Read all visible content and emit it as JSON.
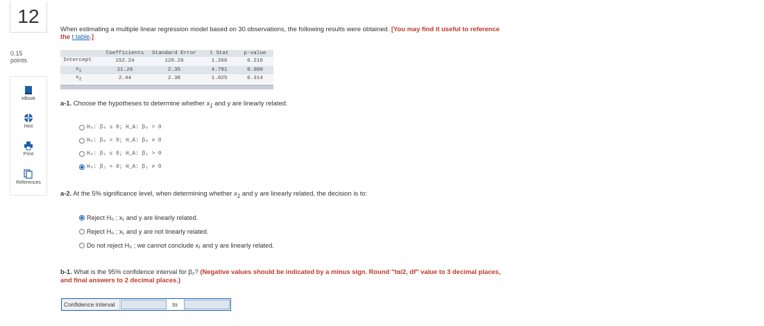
{
  "question": {
    "number": "12",
    "points_value": "0.15",
    "points_label": "points"
  },
  "tools": [
    {
      "label": "eBook",
      "icon": "book-icon"
    },
    {
      "label": "Hint",
      "icon": "lifebuoy-icon"
    },
    {
      "label": "Print",
      "icon": "printer-icon"
    },
    {
      "label": "References",
      "icon": "documents-icon"
    }
  ],
  "intro": {
    "text": "When estimating a multiple linear regression model based on 30 observations, the following results were obtained.",
    "note_prefix": "[You may find it useful to reference the",
    "link": "t table",
    "note_suffix": ".]"
  },
  "regression_table": {
    "headers": [
      "",
      "Coefficients",
      "Standard Error",
      "t Stat",
      "p-value"
    ],
    "rows": [
      {
        "label": "Intercept",
        "sub": "",
        "coef": "152.24",
        "se": "120.26",
        "t": "1.266",
        "p": "0.216"
      },
      {
        "label": "x",
        "sub": "1",
        "coef": "11.26",
        "se": "2.35",
        "t": "4.791",
        "p": "0.000"
      },
      {
        "label": "x",
        "sub": "2",
        "coef": "2.44",
        "se": "2.38",
        "t": "1.025",
        "p": "0.314"
      }
    ]
  },
  "a1": {
    "label": "a-1.",
    "text_before": "Choose the hypotheses to determine whether",
    "var": "x",
    "var_sub": "1",
    "text_after": "and y are linearly related.",
    "options": [
      {
        "text": "H₀: β₀ ≤ 0; H_A: β₀ > 0",
        "selected": false
      },
      {
        "text": "H₀: β₀ = 0; H_A: β₀ ≠ 0",
        "selected": false
      },
      {
        "text": "H₀: β₁ ≤ 0; H_A: β₁ > 0",
        "selected": false
      },
      {
        "text": "H₀: β₁ = 0; H_A: β₁ ≠ 0",
        "selected": true
      }
    ]
  },
  "a2": {
    "label": "a-2.",
    "text_before": "At the 5% significance level, when determining whether",
    "var": "x",
    "var_sub": "1",
    "text_after": "and y are linearly related, the decision is to:",
    "options": [
      {
        "text": "Reject H₀ ; x₁ and y are linearly related.",
        "selected": true
      },
      {
        "text": "Reject H₀ ; x₁ and y are not linearly related.",
        "selected": false
      },
      {
        "text": "Do not reject H₀ ; we cannot conclude x₁ and y are linearly related.",
        "selected": false
      }
    ]
  },
  "b1": {
    "label": "b-1.",
    "text_before": "What is the 95% confidence interval for β₂?",
    "instructions": "(Negative values should be indicated by a minus sign. Round \"tα/2, df\" value to 3 decimal places, and final answers to 2 decimal places.)"
  },
  "confidence_interval": {
    "label": "Confidence interval",
    "to": "to",
    "lower_value": "",
    "upper_value": ""
  },
  "colors": {
    "accent": "#1a62b9",
    "instruction_red": "#c0392b"
  }
}
